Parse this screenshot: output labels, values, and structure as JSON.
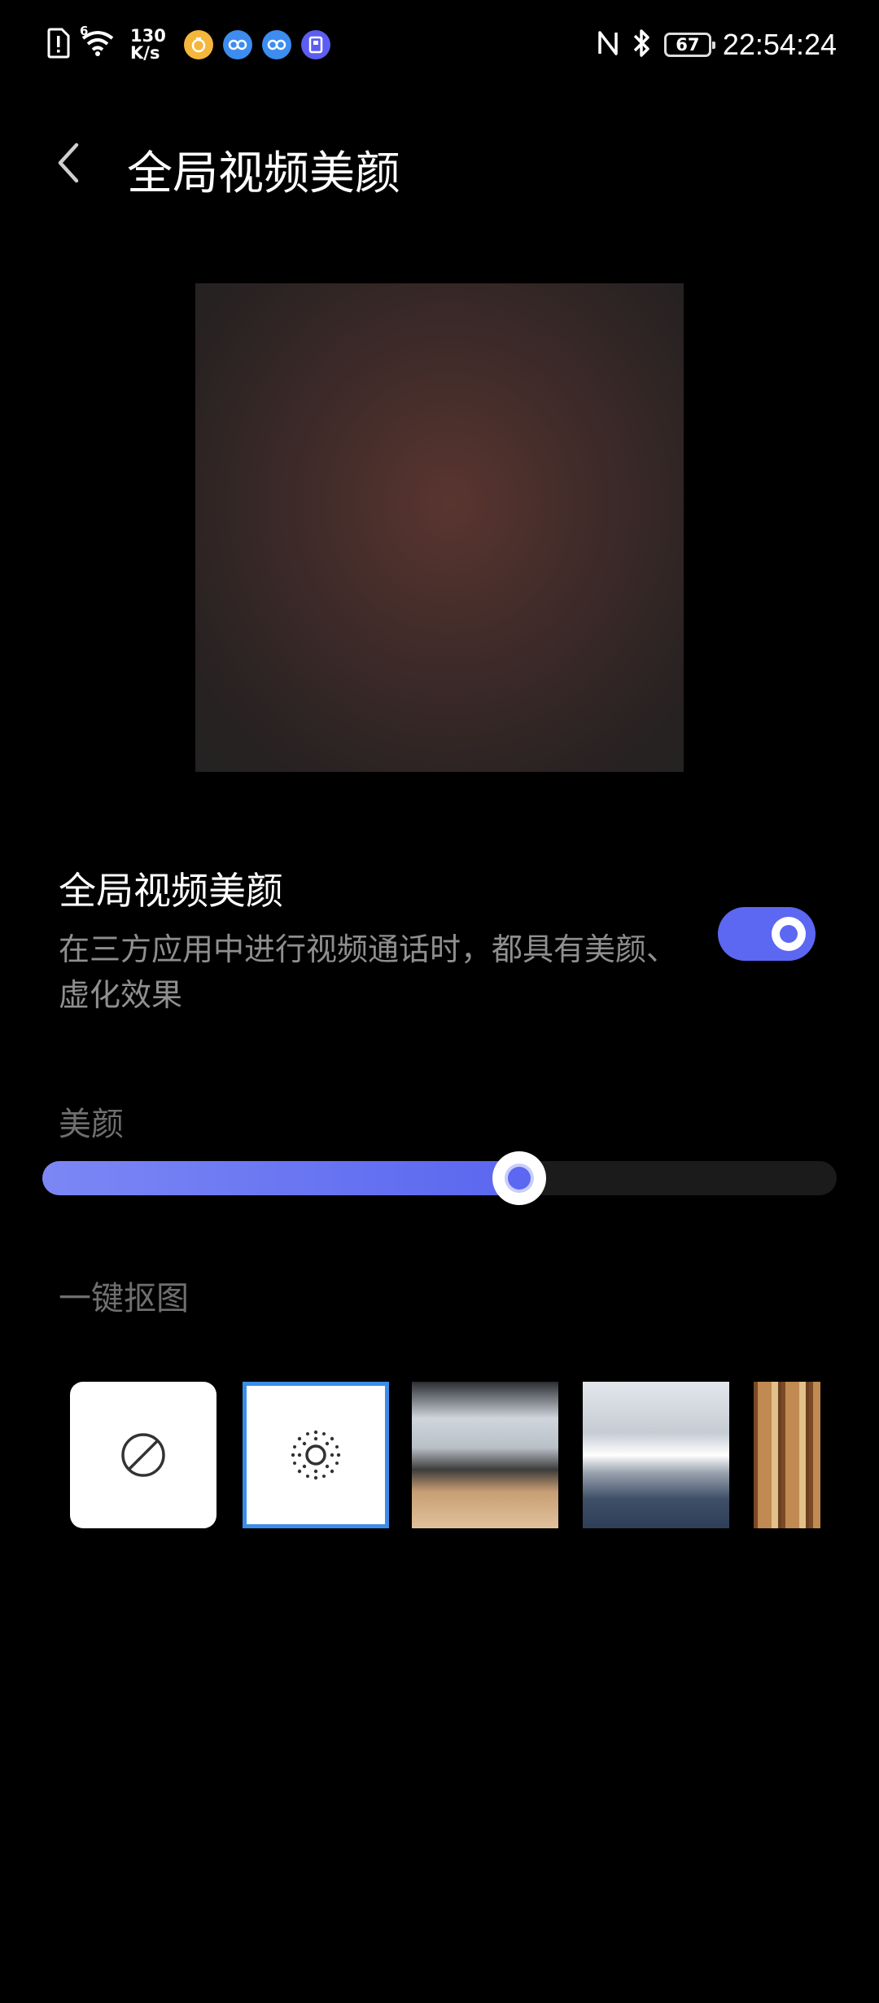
{
  "status_bar": {
    "net_speed_value": "130",
    "net_speed_unit": "K/s",
    "signal_label": "6",
    "battery": "67",
    "time": "22:54:24"
  },
  "header": {
    "title": "全局视频美颜"
  },
  "beauty_setting": {
    "title": "全局视频美颜",
    "description": "在三方应用中进行视频通话时，都具有美颜、虚化效果",
    "enabled": true
  },
  "slider": {
    "label": "美颜",
    "value_fraction": 0.6
  },
  "background": {
    "label": "一键抠图",
    "options": [
      "none",
      "blur",
      "meeting-room",
      "office",
      "bookshelf"
    ],
    "selected": "blur"
  },
  "colors": {
    "accent": "#5c67f2",
    "selection_border": "#3a8de9",
    "background": "#000000"
  }
}
